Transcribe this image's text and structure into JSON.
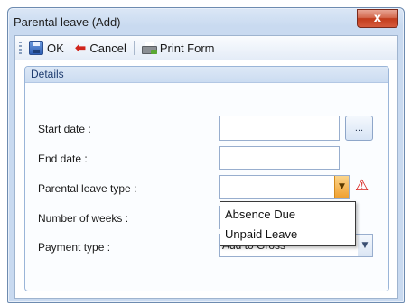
{
  "window": {
    "title": "Parental leave (Add)",
    "close_glyph": "x"
  },
  "toolbar": {
    "ok_label": "OK",
    "cancel_label": "Cancel",
    "print_label": "Print Form",
    "icons": [
      "save-icon",
      "cancel-arrow-icon",
      "print-icon"
    ]
  },
  "details": {
    "group_title": "Details",
    "start_date_label": "Start date :",
    "start_date_value": "",
    "ellipsis_label": "...",
    "end_date_label": "End date :",
    "end_date_value": "",
    "leave_type_label": "Parental leave type :",
    "leave_type_value": "",
    "weeks_label": "Number of weeks :",
    "weeks_value": "",
    "payment_type_label": "Payment type :",
    "payment_type_value": "Add to Gross"
  },
  "leave_type_dropdown": {
    "options": [
      "Absence Due",
      "Unpaid Leave"
    ]
  },
  "colors": {
    "accent": "#2f5fb5",
    "warning": "#d8201a",
    "combo_arrow_active": "#f0a030"
  }
}
